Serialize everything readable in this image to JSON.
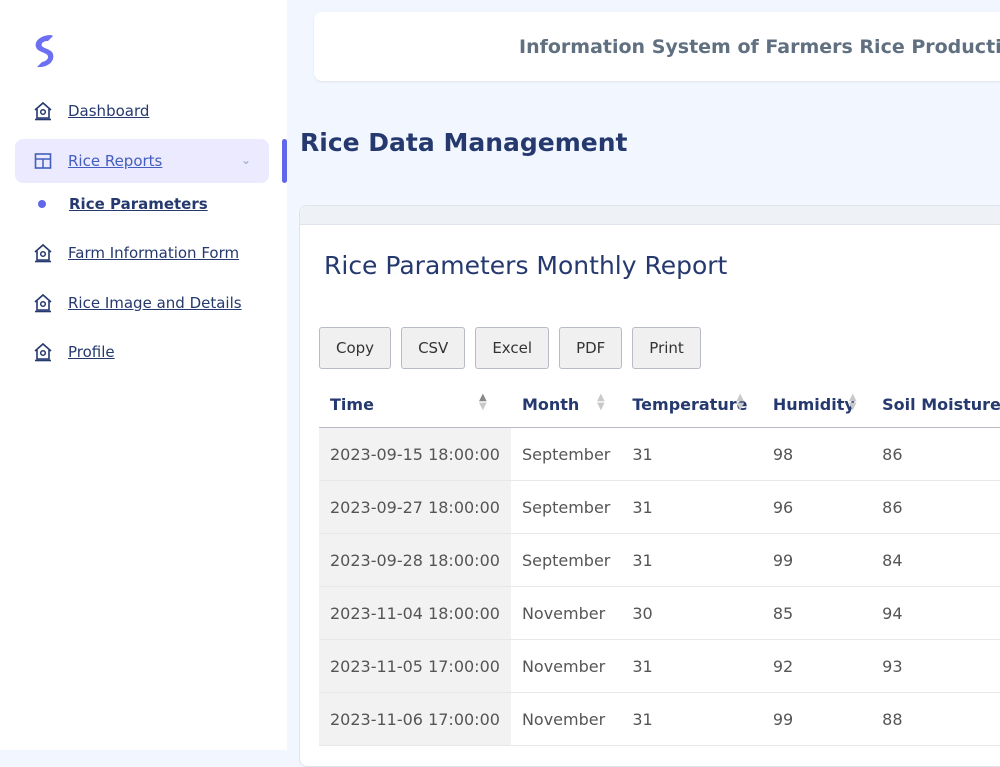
{
  "header": {
    "title": "Information System of Farmers Rice Production"
  },
  "sidebar": {
    "items": [
      {
        "label": "Dashboard",
        "icon": "home-icon"
      },
      {
        "label": "Rice Reports",
        "icon": "layout-icon",
        "active": true
      },
      {
        "label": "Rice Parameters",
        "sub": true
      },
      {
        "label": "Farm Information Form",
        "icon": "home-icon"
      },
      {
        "label": "Rice Image and Details",
        "icon": "home-icon"
      },
      {
        "label": "Profile",
        "icon": "home-icon"
      }
    ]
  },
  "page": {
    "title": "Rice Data Management"
  },
  "card": {
    "title": "Rice Parameters Monthly Report",
    "buttons": [
      "Copy",
      "CSV",
      "Excel",
      "PDF",
      "Print"
    ]
  },
  "table": {
    "columns": [
      "Time",
      "Month",
      "Temperature",
      "Humidity",
      "Soil Moisture"
    ],
    "rows": [
      [
        "2023-09-15 18:00:00",
        "September",
        "31",
        "98",
        "86"
      ],
      [
        "2023-09-27 18:00:00",
        "September",
        "31",
        "96",
        "86"
      ],
      [
        "2023-09-28 18:00:00",
        "September",
        "31",
        "99",
        "84"
      ],
      [
        "2023-11-04 18:00:00",
        "November",
        "30",
        "85",
        "94"
      ],
      [
        "2023-11-05 17:00:00",
        "November",
        "31",
        "92",
        "93"
      ],
      [
        "2023-11-06 17:00:00",
        "November",
        "31",
        "99",
        "88"
      ]
    ]
  },
  "colors": {
    "accent": "#435ebe",
    "active_bg": "#ebeafe",
    "logo": "#6c6ff2"
  }
}
